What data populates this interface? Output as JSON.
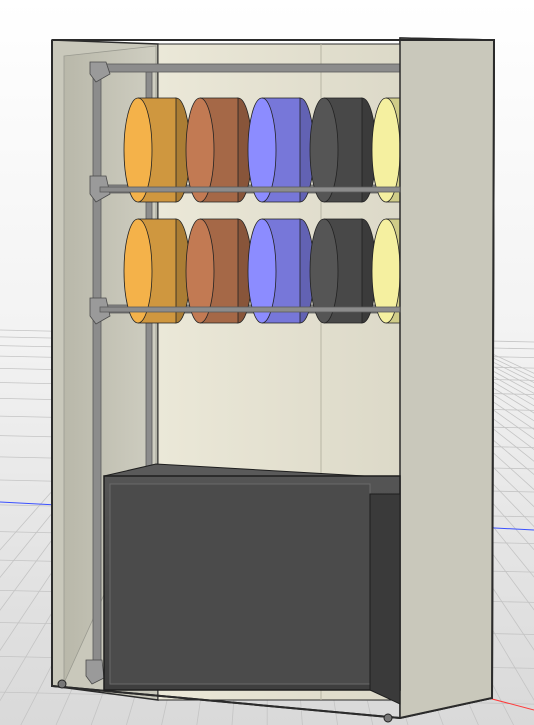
{
  "viewport": {
    "background_top": "#ffffff",
    "background_bottom": "#d9d9d9",
    "grid_color": "#c4c4c4",
    "x_axis_color": "#3a50ff",
    "y_axis_color": "#ff3a3a"
  },
  "cabinet": {
    "frame_color": "#c9c8bb",
    "back_panel_color": "#e6e3d2",
    "side_panel_color": "#c3c2b5",
    "outline_color": "#2b2b2b"
  },
  "rack": {
    "pipe_color": "#8c8c8c",
    "fitting_color": "#9a9a9a",
    "rails": 3
  },
  "spools": {
    "rows": 2,
    "filament_colors": [
      "#f4b24a",
      "#c27a53",
      "#8c8cff",
      "#555555",
      "#f5f0a0"
    ]
  },
  "drybox": {
    "color": "#4b4b4b",
    "edge_color": "#6a6a6a"
  }
}
